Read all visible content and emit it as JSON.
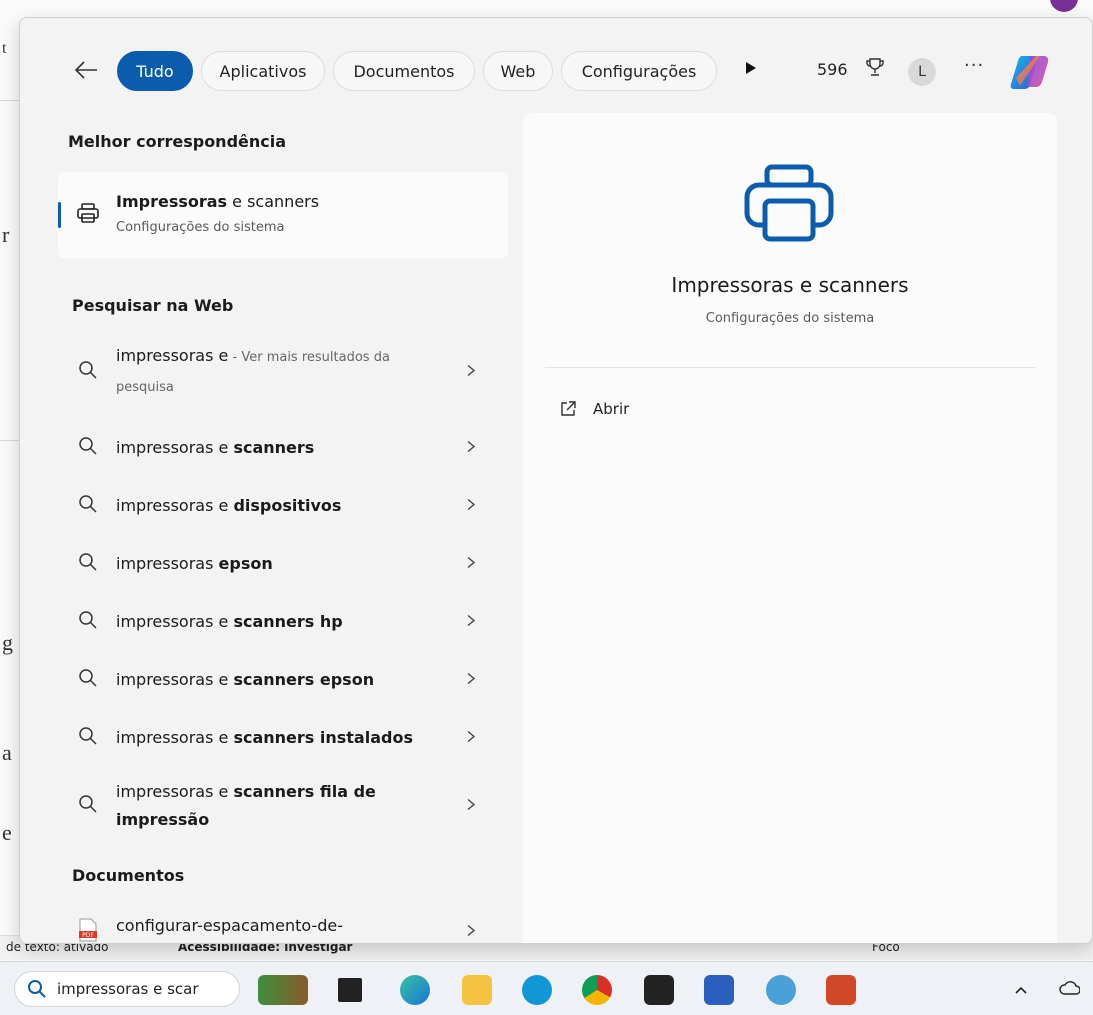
{
  "background": {
    "status_bar": {
      "text_mode": "de texto: ativado",
      "accessibility": "Acessibilidade: investigar",
      "focus": "Foco"
    }
  },
  "topbar": {
    "tabs": [
      {
        "label": "Tudo",
        "active": true
      },
      {
        "label": "Aplicativos",
        "active": false
      },
      {
        "label": "Documentos",
        "active": false
      },
      {
        "label": "Web",
        "active": false
      },
      {
        "label": "Configurações",
        "active": false
      }
    ],
    "score": "596",
    "avatar_initial": "L",
    "more": "···"
  },
  "left": {
    "best_match_heading": "Melhor correspondência",
    "best_match": {
      "title_bold": "Impressoras",
      "title_rest": " e scanners",
      "subtitle": "Configurações do sistema"
    },
    "web_heading": "Pesquisar na Web",
    "web_results": [
      {
        "plain": "impressoras e",
        "bold": "",
        "hint": " - Ver mais resultados da pesquisa"
      },
      {
        "plain": "impressoras e ",
        "bold": "scanners",
        "hint": ""
      },
      {
        "plain": "impressoras e ",
        "bold": "dispositivos",
        "hint": ""
      },
      {
        "plain": "impressoras ",
        "bold": "epson",
        "hint": ""
      },
      {
        "plain": "impressoras e ",
        "bold": "scanners hp",
        "hint": ""
      },
      {
        "plain": "impressoras e ",
        "bold": "scanners epson",
        "hint": ""
      },
      {
        "plain": "impressoras e ",
        "bold": "scanners instalados",
        "hint": ""
      },
      {
        "plain": "impressoras e ",
        "bold": "scanners fila de impressão",
        "hint": ""
      }
    ],
    "docs_heading": "Documentos",
    "doc_result": "configurar-espacamento-de-"
  },
  "right": {
    "title": "Impressoras e scanners",
    "subtitle": "Configurações do sistema",
    "open_label": "Abrir"
  },
  "taskbar": {
    "search_text": "impressoras e scar"
  },
  "colors": {
    "accent": "#0b5cad",
    "panel": "#f3f3f3"
  }
}
